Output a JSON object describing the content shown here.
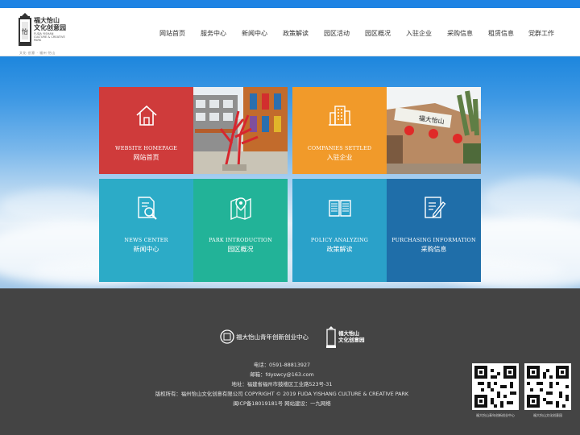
{
  "brand": {
    "name_line1": "福大怡山",
    "name_line2": "文化创意园",
    "name_en": "FUDA YISHAN CULTURE & CREATIVE PARK",
    "subtitle": "文化·创意 · 福州·怡山"
  },
  "nav": {
    "items": [
      "网站首页",
      "服务中心",
      "新闻中心",
      "政策解读",
      "园区活动",
      "园区概况",
      "入驻企业",
      "采购信息",
      "租赁信息",
      "党群工作"
    ]
  },
  "tiles": {
    "home": {
      "en": "WEBSITE HOMEPAGE",
      "cn": "网站首页",
      "color": "#cf3b3b"
    },
    "companies": {
      "en": "COMPANIES SETTLED",
      "cn": "入驻企业",
      "color": "#f19a2a"
    },
    "news": {
      "en": "NEWS CENTER",
      "cn": "新闻中心",
      "color": "#2cabc7"
    },
    "park": {
      "en": "PARK INTRODUCTION",
      "cn": "园区概况",
      "color": "#22b398"
    },
    "policy": {
      "en": "POLICY ANALYZING",
      "cn": "政策解读",
      "color": "#2aa1c9"
    },
    "purchasing": {
      "en": "PURCHASING INFORMATION",
      "cn": "采购信息",
      "color": "#1f6ea9"
    }
  },
  "footer": {
    "center_name": "福大怡山青年创新创业中心",
    "logo_line1": "福大怡山",
    "logo_line2": "文化创意园",
    "phone": "电话：0591-88813927",
    "email": "邮箱：fdyswcy@163.com",
    "address": "地址：福建省福州市鼓楼区工业路523号-31",
    "copyright": "版权所有：福州怡山文化创意有限公司    COPYRIGHT © 2019 FUDA YISHANG CULTURE & CREATIVE PARK",
    "icp": "闽ICP备18019181号    网站建设：一九网络",
    "qr1_caption": "福大怡山青年创新创业中心",
    "qr2_caption": "福大怡山文化创意园"
  }
}
